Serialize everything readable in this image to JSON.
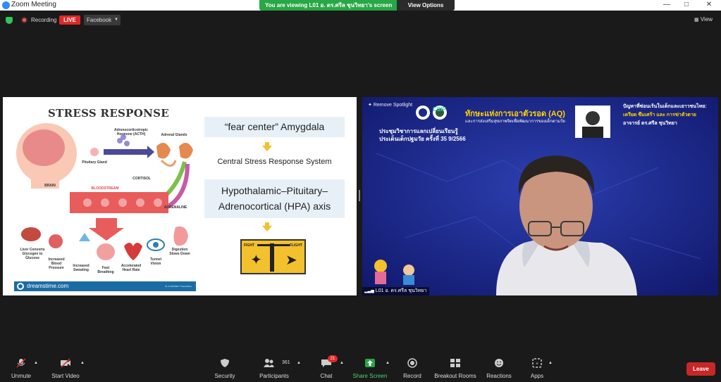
{
  "window": {
    "title": "Zoom Meeting"
  },
  "banner": {
    "message": "You are viewing L01 อ. ดร.ศรีล ชุนวิทยา's screen",
    "view_options": "View Options"
  },
  "status": {
    "recording": "Recording",
    "live": "LIVE",
    "stream_target": "Facebook",
    "view": "View"
  },
  "slide": {
    "title": "STRESS RESPONSE",
    "labels": {
      "acth": "Adrenocorticotropic Hormone (ACTH)",
      "adrenal": "Adrenal Glands",
      "pituitary": "Pituitary Gland",
      "brain": "BRAIN",
      "cortisol": "CORTISOL",
      "bloodstream": "BLOODSTREAM",
      "adrenaline": "ADRENALINE",
      "liver": "Liver Converts Glycogen to Glucose",
      "bp": "Increased Blood Pressure",
      "sweat": "Increased Sweating",
      "breath": "Fast Breathing",
      "heart": "Accelerated Heart Rate",
      "tunnel": "Tunnel Vision",
      "digest": "Digestion Slows Down"
    },
    "box1": "“fear center” Amygdala",
    "central": "Central Stress Response System",
    "box2_line1": "Hypothalamic–Pituitary–",
    "box2_line2": "Adrenocortical (HPA) axis",
    "fight": "FIGHT",
    "flight": "FLIGHT",
    "footer": "dreamstime.com",
    "footer_id": "ID 171857883 © VectorMine"
  },
  "speaker": {
    "remove_spotlight": "Remove Spotlight",
    "csip": "CSIP",
    "headline": "ทักษะแห่งการเอาตัวรอด (AQ)",
    "subline": "และการส่งเสริมสุขภาพจิตเพื่อพัฒนาการของเด็กตามวัย",
    "event1": "ประชุมวิชาการแลกเปลี่ยนเรียนรู้",
    "event2": "ประเด็นเด็กปฐมวัย ครั้งที่ 35  9/2566",
    "right1": "ปัญหาที่ซ่อนเร้นในเด็กและเยาวชนไทย:",
    "right2": "เครียด ซึมเศร้า และ การฆ่าตัวตาย",
    "right3": "อาจารย์ ดร.ศรีล ชุนวิทยา",
    "name": "L01 อ. ดร.ศรีล ชุนวิทยา"
  },
  "toolbar": {
    "unmute": "Unmute",
    "start_video": "Start Video",
    "security": "Security",
    "participants": "Participants",
    "participants_count": "361",
    "chat": "Chat",
    "chat_badge": "21",
    "share": "Share Screen",
    "record": "Record",
    "breakout": "Breakout Rooms",
    "reactions": "Reactions",
    "apps": "Apps",
    "leave": "Leave"
  },
  "colors": {
    "accent_green": "#27a745",
    "leave_red": "#c72727",
    "live_red": "#e02828",
    "zoom_blue": "#2d8cff"
  }
}
